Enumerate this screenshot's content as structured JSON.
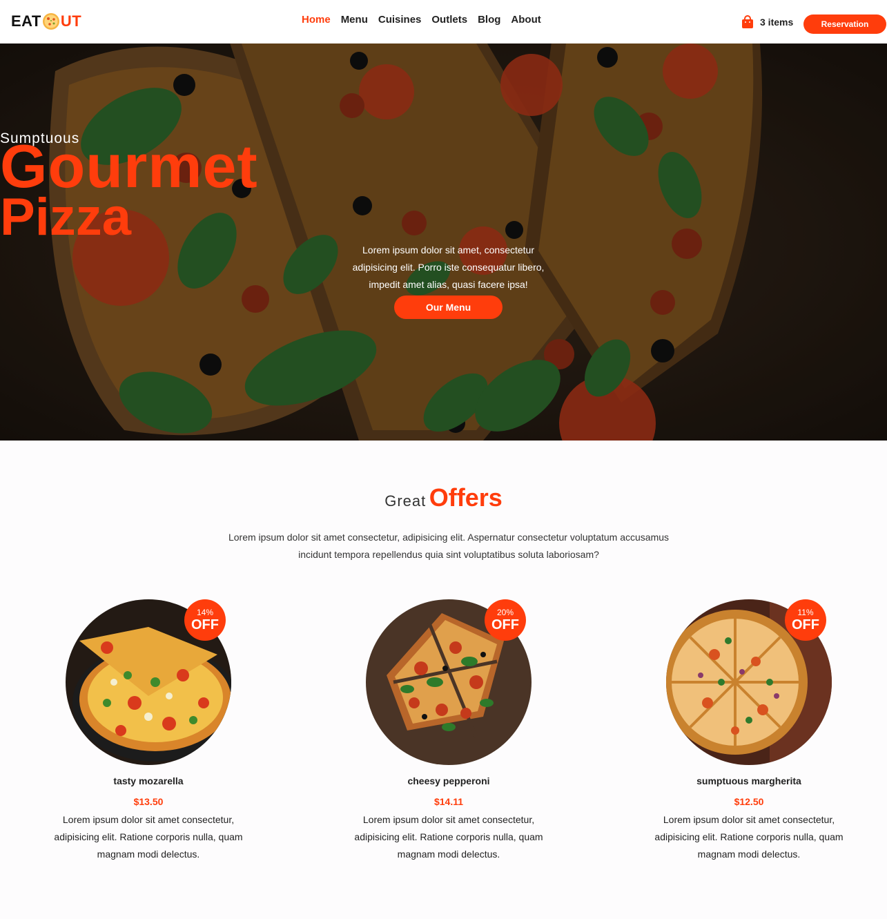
{
  "brand": {
    "left": "EAT",
    "right": "UT"
  },
  "nav": {
    "links": [
      "Home",
      "Menu",
      "Cuisines",
      "Outlets",
      "Blog",
      "About"
    ],
    "active": "Home",
    "cart_label": "3 items",
    "reserve_label": "Reservation"
  },
  "hero": {
    "pre": "Sumptuous",
    "title_line1": "Gourmet",
    "title_line2": "Pizza",
    "desc": "Lorem ipsum dolor sit amet, consectetur adipisicing elit. Porro iste consequatur libero, impedit amet alias, quasi facere ipsa!",
    "button": "Our Menu"
  },
  "offers": {
    "heading_small": "Great",
    "heading_big": "Offers",
    "desc": "Lorem ipsum dolor sit amet consectetur, adipisicing elit. Aspernatur consectetur voluptatum accusamus incidunt tempora repellendus quia sint voluptatibus soluta laboriosam?",
    "items": [
      {
        "discount": "14%",
        "off": "OFF",
        "name": "tasty mozarella",
        "price": "$13.50",
        "text": "Lorem ipsum dolor sit amet consectetur, adipisicing elit. Ratione corporis nulla, quam magnam modi delectus."
      },
      {
        "discount": "20%",
        "off": "OFF",
        "name": "cheesy pepperoni",
        "price": "$14.11",
        "text": "Lorem ipsum dolor sit amet consectetur, adipisicing elit. Ratione corporis nulla, quam magnam modi delectus."
      },
      {
        "discount": "11%",
        "off": "OFF",
        "name": "sumptuous margherita",
        "price": "$12.50",
        "text": "Lorem ipsum dolor sit amet consectetur, adipisicing elit. Ratione corporis nulla, quam magnam modi delectus."
      }
    ]
  },
  "colors": {
    "accent": "#ff3d0c",
    "text": "#222222",
    "hero_bg": "#2a211a"
  },
  "icons": {
    "cart": "shopping-bag-icon",
    "logo_mark": "pizza-icon"
  }
}
